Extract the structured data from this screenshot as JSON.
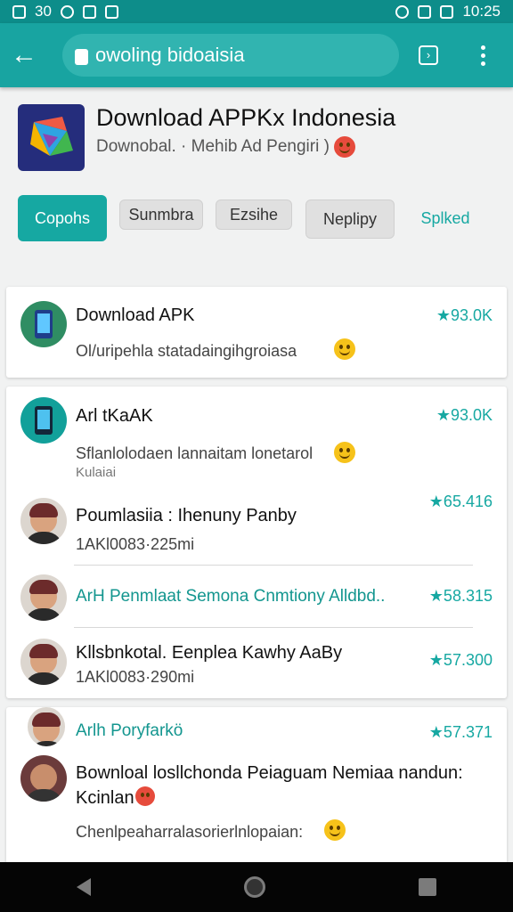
{
  "statusbar": {
    "left_text": "30",
    "time": "10:25"
  },
  "addressbar": {
    "url": "owoling bidoaisia"
  },
  "header": {
    "title": "Download APPKx Indonesia",
    "subtitle": "Downobal. · Mehib Ad Pengiri )"
  },
  "chips": [
    "Copohs",
    "Sunmbra",
    "Ezsihe",
    "Neplipy",
    "Splked"
  ],
  "list": [
    {
      "title": "Download APK",
      "subtitle": "Ol/uripehla statadaingihgroiasa",
      "rating": "★93.0K"
    },
    {
      "title": "Arl tKaAK",
      "subtitle": "Sflanlolodaen lannaitam lonetarol",
      "extra": "Kulaiai",
      "rating": "★93.0K"
    },
    {
      "title": "Poumlasiia : Ihenuny Panby",
      "subtitle": "1AKl0083·225mi",
      "rating": "★65.416"
    },
    {
      "title": "ArH Penmlaat Semona Cnmtiony Alldbd..",
      "rating": "★58.315"
    },
    {
      "title": "Kllsbnkotal. Eenplea Kawhy AaBy",
      "subtitle": "1AKl0083·290mi",
      "rating": "★57.300"
    },
    {
      "title": "Arlh Poryfarkö",
      "rating": "★57.371"
    },
    {
      "title": "Bownloal losllchonda Peiaguam Nemiaa nandun: Kcinlan",
      "subtitle": "Chenlpeaharralasorierlnlopaian:"
    }
  ]
}
